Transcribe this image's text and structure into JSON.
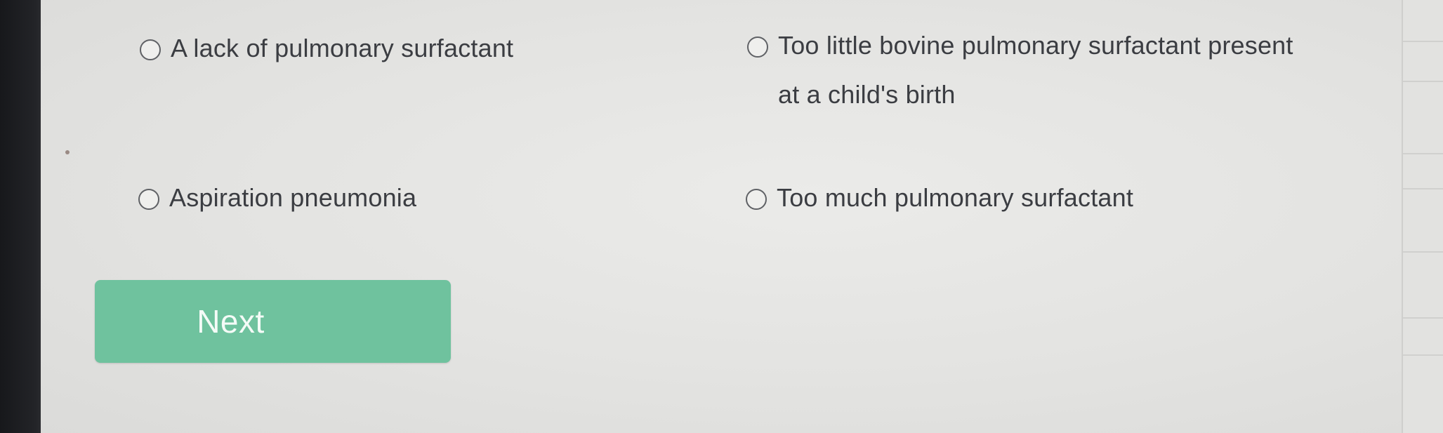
{
  "question": {
    "options": [
      {
        "label": "A lack of pulmonary surfactant",
        "selected": false
      },
      {
        "label": "Too little bovine pulmonary surfactant present at a child's birth",
        "selected": false
      },
      {
        "label": "Aspiration pneumonia",
        "selected": false
      },
      {
        "label": "Too much pulmonary surfactant",
        "selected": false
      }
    ]
  },
  "actions": {
    "next_label": "Next",
    "next_color": "#6fc29e"
  }
}
